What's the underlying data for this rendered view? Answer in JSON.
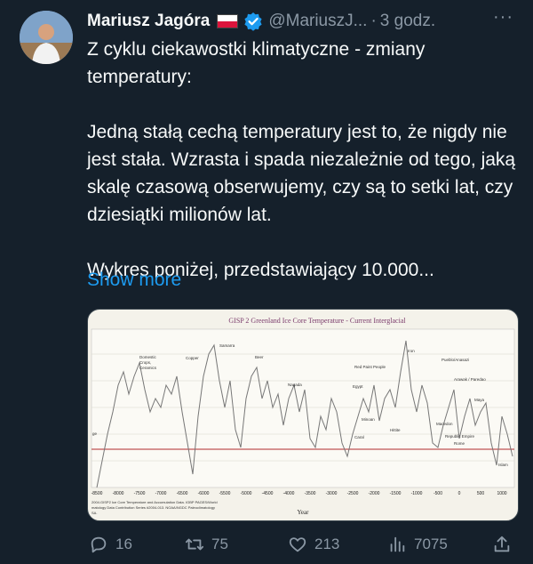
{
  "tweet": {
    "author_name": "Mariusz Jagóra",
    "handle": "@MariuszJ...",
    "separator": "·",
    "time": "3 godz.",
    "more_glyph": "···",
    "paragraph1": "Z cyklu ciekawostki klimatyczne - zmiany temperatury:",
    "paragraph2": "Jedną stałą cechą temperatury jest to, że nigdy nie jest stała. Wzrasta i spada niezależnie od tego, jaką skalę czasową obserwujemy, czy są to setki lat, czy dziesiątki milionów lat.",
    "paragraph3": "Wykres poniżej, przedstawiający 10.000...",
    "show_more": "Show more"
  },
  "chart": {
    "title": "GISP 2 Greenland Ice Core Temperature - Current Interglacial",
    "xlabel": "Year",
    "xticks": [
      "-8500",
      "-8000",
      "-7500",
      "-7000",
      "-6500",
      "-6000",
      "-5500",
      "-5000",
      "-4500",
      "-4000",
      "-3500",
      "-3000",
      "-2500",
      "-2000",
      "-1500",
      "-1000",
      "-500",
      "0",
      "500",
      "1000"
    ],
    "source_lines": [
      "2004.GISP2 Ice Core Temperature and Accumulation Data. IGBP PAGES/World",
      "matology Data Contribution Series #2004-013. NOAA/NGDC Paleoclimatology",
      "SA."
    ],
    "left_label": "ge",
    "annotations": [
      "Domestic",
      "Crops,",
      "Ceramics",
      "Copper",
      "Samarra",
      "Beer",
      "Naqada",
      "Red Paint People",
      "Egypt",
      "Iron",
      "Pueblo/Anasazi",
      "Arawak / Paredao",
      "Maya",
      "Minoan",
      "Hittite",
      "Caral",
      "Macedon",
      "Republic Empire",
      "Rome",
      "Islam"
    ]
  },
  "actions": {
    "replies": "16",
    "retweets": "75",
    "likes": "213",
    "views": "7075"
  }
}
